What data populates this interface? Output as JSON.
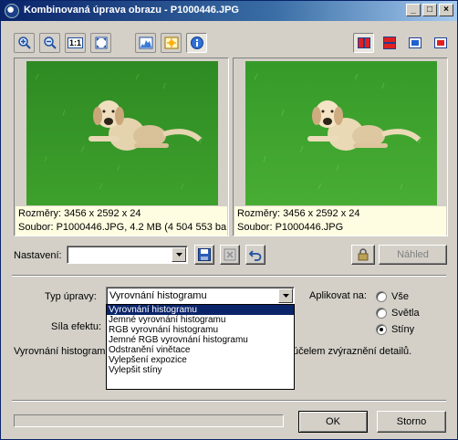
{
  "window": {
    "title": "Kombinovaná úprava obrazu - P1000446.JPG",
    "controls": [
      "minimize-icon",
      "maximize-icon",
      "close-icon"
    ]
  },
  "toolbar": {
    "left_icons": [
      "zoom-in-icon",
      "zoom-out-icon",
      "actual-size-icon",
      "fit-to-window-icon",
      "histogram-icon",
      "effects-icon",
      "info-icon"
    ],
    "actual_size_text": "1:1",
    "right_icons": [
      "split-vertical-icon",
      "split-horizontal-icon",
      "original-only-icon",
      "result-only-icon"
    ]
  },
  "preview_left": {
    "size": "Rozměry: 3456 x 2592 x 24",
    "file": "Soubor: P1000446.JPG, 4.2 MB (4 504 553 ba..."
  },
  "preview_right": {
    "size": "Rozměry: 3456 x 2592 x 24",
    "file": "Soubor: P1000446.JPG"
  },
  "settings": {
    "label": "Nastavení:",
    "value": "",
    "save_icon": "save-icon",
    "delete_icon": "delete-icon",
    "undo_icon": "undo-icon",
    "lock_icon": "lock-icon",
    "preview_label": "Náhled"
  },
  "adjust": {
    "type_label": "Typ úpravy:",
    "type_value": "Vyrovnání histogramu",
    "strength_label": "Síla efektu:",
    "description_start": "Vyrovnání histogram",
    "description_end": "účelem zvýraznění detailů.",
    "options": [
      "Vyrovnání histogramu",
      "Jemné vyrovnání histogramu",
      "RGB vyrovnání histogramu",
      "Jemné RGB vyrovnání histogramu",
      "Odstranění vinětace",
      "Vylepšení expozice",
      "Vylepšit stíny"
    ],
    "selected_index": 0
  },
  "apply": {
    "label": "Aplikovat na:",
    "options": [
      "Vše",
      "Světla",
      "Stíny"
    ],
    "selected": "Stíny"
  },
  "buttons": {
    "ok": "OK",
    "cancel": "Storno"
  },
  "progress": 0
}
